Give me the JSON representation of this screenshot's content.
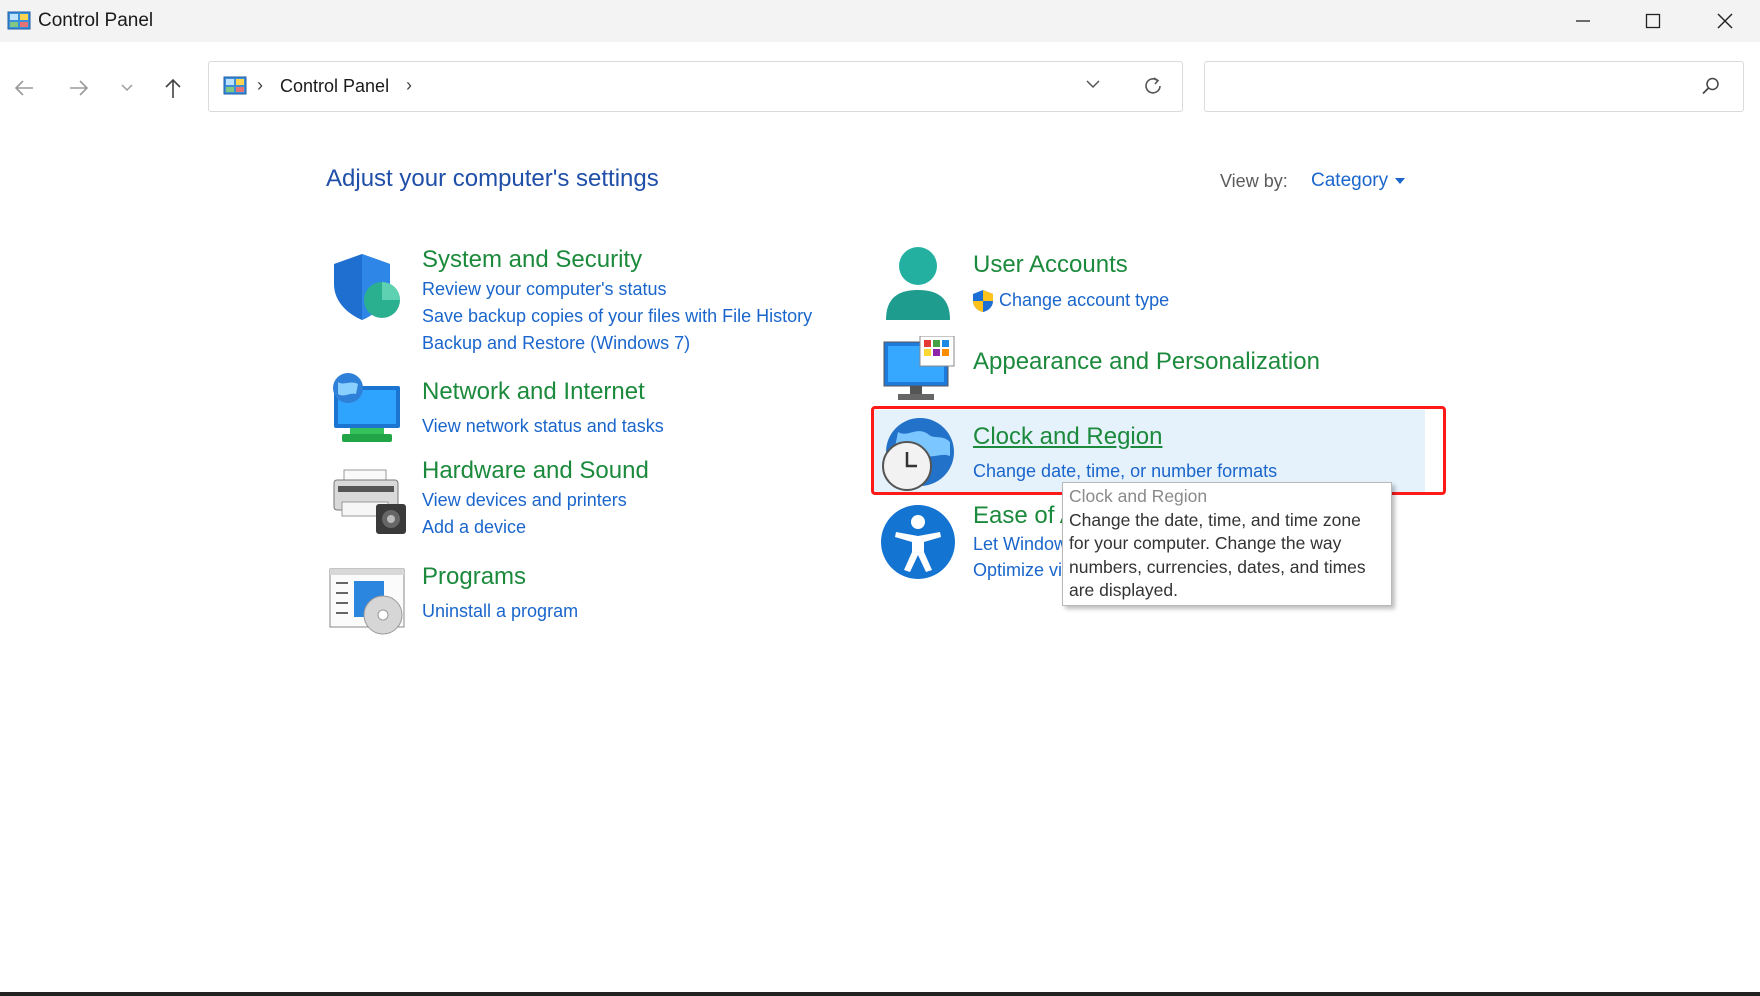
{
  "window": {
    "title": "Control Panel"
  },
  "address": {
    "crumb": "Control Panel",
    "separator": "›"
  },
  "search": {
    "placeholder": "",
    "value": ""
  },
  "page": {
    "heading": "Adjust your computer's settings",
    "view_by_label": "View by:",
    "view_by_value": "Category"
  },
  "categories": {
    "system_security": {
      "title": "System and Security",
      "links": [
        "Review your computer's status",
        "Save backup copies of your files with File History",
        "Backup and Restore (Windows 7)"
      ]
    },
    "network": {
      "title": "Network and Internet",
      "links": [
        "View network status and tasks"
      ]
    },
    "hardware": {
      "title": "Hardware and Sound",
      "links": [
        "View devices and printers",
        "Add a device"
      ]
    },
    "programs": {
      "title": "Programs",
      "links": [
        "Uninstall a program"
      ]
    },
    "user_accounts": {
      "title": "User Accounts",
      "links": [
        "Change account type"
      ]
    },
    "appearance": {
      "title": "Appearance and Personalization"
    },
    "clock_region": {
      "title": "Clock and Region",
      "links": [
        "Change date, time, or number formats"
      ]
    },
    "ease_of_access": {
      "title": "Ease of Access",
      "links": [
        "Let Windows suggest settings",
        "Optimize visual display"
      ]
    }
  },
  "tooltip": {
    "title": "Clock and Region",
    "lines": [
      "Change the date, time, and time zone",
      "for your computer. Change the way",
      "numbers, currencies, dates, and times",
      "are displayed."
    ]
  },
  "colors": {
    "category_title": "#1c8a3c",
    "link": "#1a66cc",
    "heading": "#1f4fa8",
    "highlight": "#ff1a1a",
    "hover": "#e5f1fb"
  }
}
